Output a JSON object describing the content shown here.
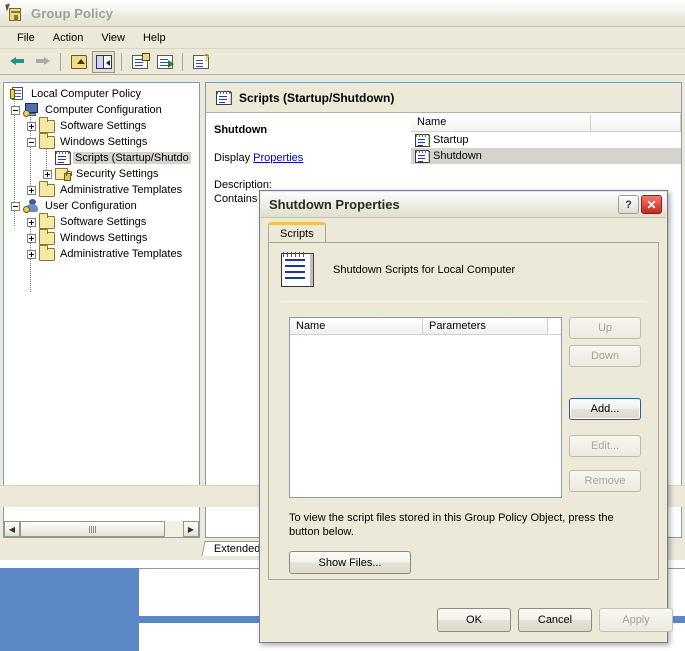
{
  "window": {
    "title": "Group Policy",
    "icon": "group-policy-icon",
    "menu": [
      "File",
      "Action",
      "View",
      "Help"
    ],
    "toolbar": [
      {
        "name": "back-button",
        "icon": "back-arrow-icon",
        "enabled": true
      },
      {
        "name": "forward-button",
        "icon": "forward-arrow-icon",
        "enabled": false
      },
      {
        "name": "up-one-level-button",
        "icon": "up-folder-icon",
        "enabled": true
      },
      {
        "name": "show-hide-tree-button",
        "icon": "split-panes-icon",
        "enabled": true,
        "pressed": true
      },
      {
        "name": "properties-button",
        "icon": "properties-icon",
        "enabled": true
      },
      {
        "name": "export-list-button",
        "icon": "export-list-icon",
        "enabled": true
      },
      {
        "name": "help-button",
        "icon": "help-document-icon",
        "enabled": true
      }
    ]
  },
  "tree": {
    "root": {
      "label": "Local Computer Policy",
      "icon": "policy-icon"
    },
    "nodes": [
      {
        "label": "Computer Configuration",
        "icon": "computer-icon",
        "expander": "minus",
        "depth": 1
      },
      {
        "label": "Software Settings",
        "icon": "folder-icon",
        "expander": "plus",
        "depth": 2
      },
      {
        "label": "Windows Settings",
        "icon": "folder-icon",
        "expander": "minus",
        "depth": 2
      },
      {
        "label": "Scripts (Startup/Shutdo",
        "icon": "script-icon",
        "expander": "none",
        "depth": 3,
        "selected": true
      },
      {
        "label": "Security Settings",
        "icon": "security-folder-icon",
        "expander": "plus",
        "depth": 3
      },
      {
        "label": "Administrative Templates",
        "icon": "folder-icon",
        "expander": "plus",
        "depth": 2
      },
      {
        "label": "User Configuration",
        "icon": "user-icon",
        "expander": "minus",
        "depth": 1
      },
      {
        "label": "Software Settings",
        "icon": "folder-icon",
        "expander": "plus",
        "depth": 2
      },
      {
        "label": "Windows Settings",
        "icon": "folder-icon",
        "expander": "plus",
        "depth": 2
      },
      {
        "label": "Administrative Templates",
        "icon": "folder-icon",
        "expander": "plus",
        "depth": 2
      }
    ],
    "hscroll": {
      "left_arrow": "◀",
      "right_arrow": "▶"
    }
  },
  "right_pane": {
    "header_title": "Scripts (Startup/Shutdown)",
    "header_icon": "script-icon",
    "extended_heading": "Shutdown",
    "display_label": "Display",
    "display_link": "Properties",
    "description_label": "Description:",
    "description_text": "Contains c",
    "list_columns": [
      "Name",
      ""
    ],
    "list_items": [
      {
        "name": "Startup",
        "icon": "script-icon",
        "selected": false
      },
      {
        "name": "Shutdown",
        "icon": "script-icon",
        "selected": true
      }
    ],
    "tabs": [
      {
        "label": "Extended",
        "active": true
      }
    ]
  },
  "dialog": {
    "title": "Shutdown Properties",
    "help_button": "?",
    "close_button": "✕",
    "tabs": [
      {
        "label": "Scripts",
        "active": true
      }
    ],
    "header_icon": "script-document-icon",
    "header_caption": "Shutdown Scripts for Local Computer",
    "list_columns": [
      "Name",
      "Parameters"
    ],
    "list_rows": [],
    "side_buttons": [
      {
        "label": "Up",
        "enabled": false,
        "default": false
      },
      {
        "label": "Down",
        "enabled": false,
        "default": false
      },
      {
        "label": "Add...",
        "enabled": true,
        "default": true
      },
      {
        "label": "Edit...",
        "enabled": false,
        "default": false
      },
      {
        "label": "Remove",
        "enabled": false,
        "default": false
      }
    ],
    "note": "To view the script files stored in this Group Policy Object, press the button below.",
    "show_files_label": "Show Files...",
    "footer_buttons": [
      {
        "label": "OK",
        "enabled": true
      },
      {
        "label": "Cancel",
        "enabled": true
      },
      {
        "label": "Apply",
        "enabled": false
      }
    ]
  },
  "colors": {
    "desktop_blue": "#5b87c5",
    "window_face": "#ece9d8",
    "selection_inactive": "#d6d3ce",
    "link": "#0000cc",
    "tab_accent": "#f5c14b",
    "close_red": "#c6291c"
  }
}
